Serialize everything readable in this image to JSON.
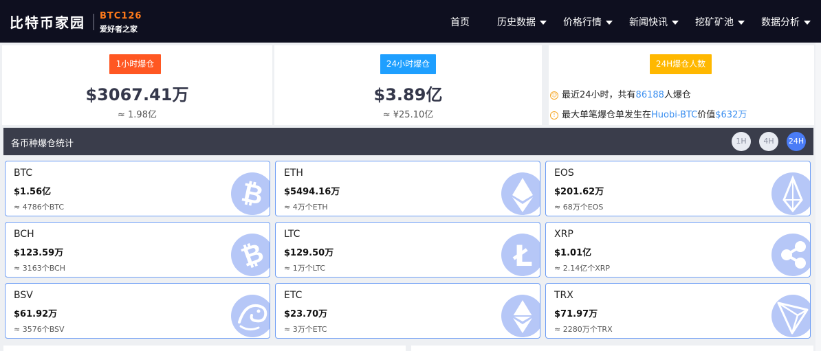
{
  "header": {
    "logo_main": "比特币家园",
    "logo_brand": "BTC126",
    "logo_slogan": "爱好者之家",
    "nav": [
      {
        "label": "首页",
        "has_dropdown": false
      },
      {
        "label": "历史数据",
        "has_dropdown": true
      },
      {
        "label": "价格行情",
        "has_dropdown": true
      },
      {
        "label": "新闻快讯",
        "has_dropdown": true
      },
      {
        "label": "挖矿矿池",
        "has_dropdown": true
      },
      {
        "label": "数据分析",
        "has_dropdown": true
      }
    ]
  },
  "summary": {
    "hour1": {
      "tag": "1小时爆仓",
      "amount": "$3067.41万",
      "approx": "≈ 1.98亿",
      "tag_color": "#ff5722"
    },
    "hour24": {
      "tag": "24小时爆仓",
      "amount": "$3.89亿",
      "approx": "≈ ¥25.10亿",
      "tag_color": "#1e9fff"
    },
    "people24": {
      "tag": "24H爆仓人数",
      "tag_color": "#ffb800",
      "line1_prefix": "最近24小时，共有",
      "line1_count": "86188",
      "line1_suffix": "人爆仓",
      "line2_prefix": "最大单笔爆仓单发生在",
      "line2_exchange": "Huobi-BTC",
      "line2_mid": "价值",
      "line2_value": "$632万"
    }
  },
  "stats": {
    "title": "各币种爆仓统计",
    "periods": [
      {
        "label": "1H",
        "active": false
      },
      {
        "label": "4H",
        "active": false
      },
      {
        "label": "24H",
        "active": true
      }
    ],
    "coins": [
      {
        "name": "BTC",
        "value": "$1.56亿",
        "qty": "≈ 4786个BTC",
        "icon": "bitcoin-icon"
      },
      {
        "name": "ETH",
        "value": "$5494.16万",
        "qty": "≈ 4万个ETH",
        "icon": "ethereum-icon"
      },
      {
        "name": "EOS",
        "value": "$201.62万",
        "qty": "≈ 68万个EOS",
        "icon": "eos-icon"
      },
      {
        "name": "BCH",
        "value": "$123.59万",
        "qty": "≈ 3163个BCH",
        "icon": "bitcoin-cash-icon"
      },
      {
        "name": "LTC",
        "value": "$129.50万",
        "qty": "≈ 1万个LTC",
        "icon": "litecoin-icon"
      },
      {
        "name": "XRP",
        "value": "$1.01亿",
        "qty": "≈ 2.14亿个XRP",
        "icon": "ripple-icon"
      },
      {
        "name": "BSV",
        "value": "$61.92万",
        "qty": "≈ 3576个BSV",
        "icon": "dragon-icon"
      },
      {
        "name": "ETC",
        "value": "$23.70万",
        "qty": "≈ 3万个ETC",
        "icon": "ethereum-classic-icon"
      },
      {
        "name": "TRX",
        "value": "$71.97万",
        "qty": "≈ 2280万个TRX",
        "icon": "tron-icon"
      }
    ]
  }
}
